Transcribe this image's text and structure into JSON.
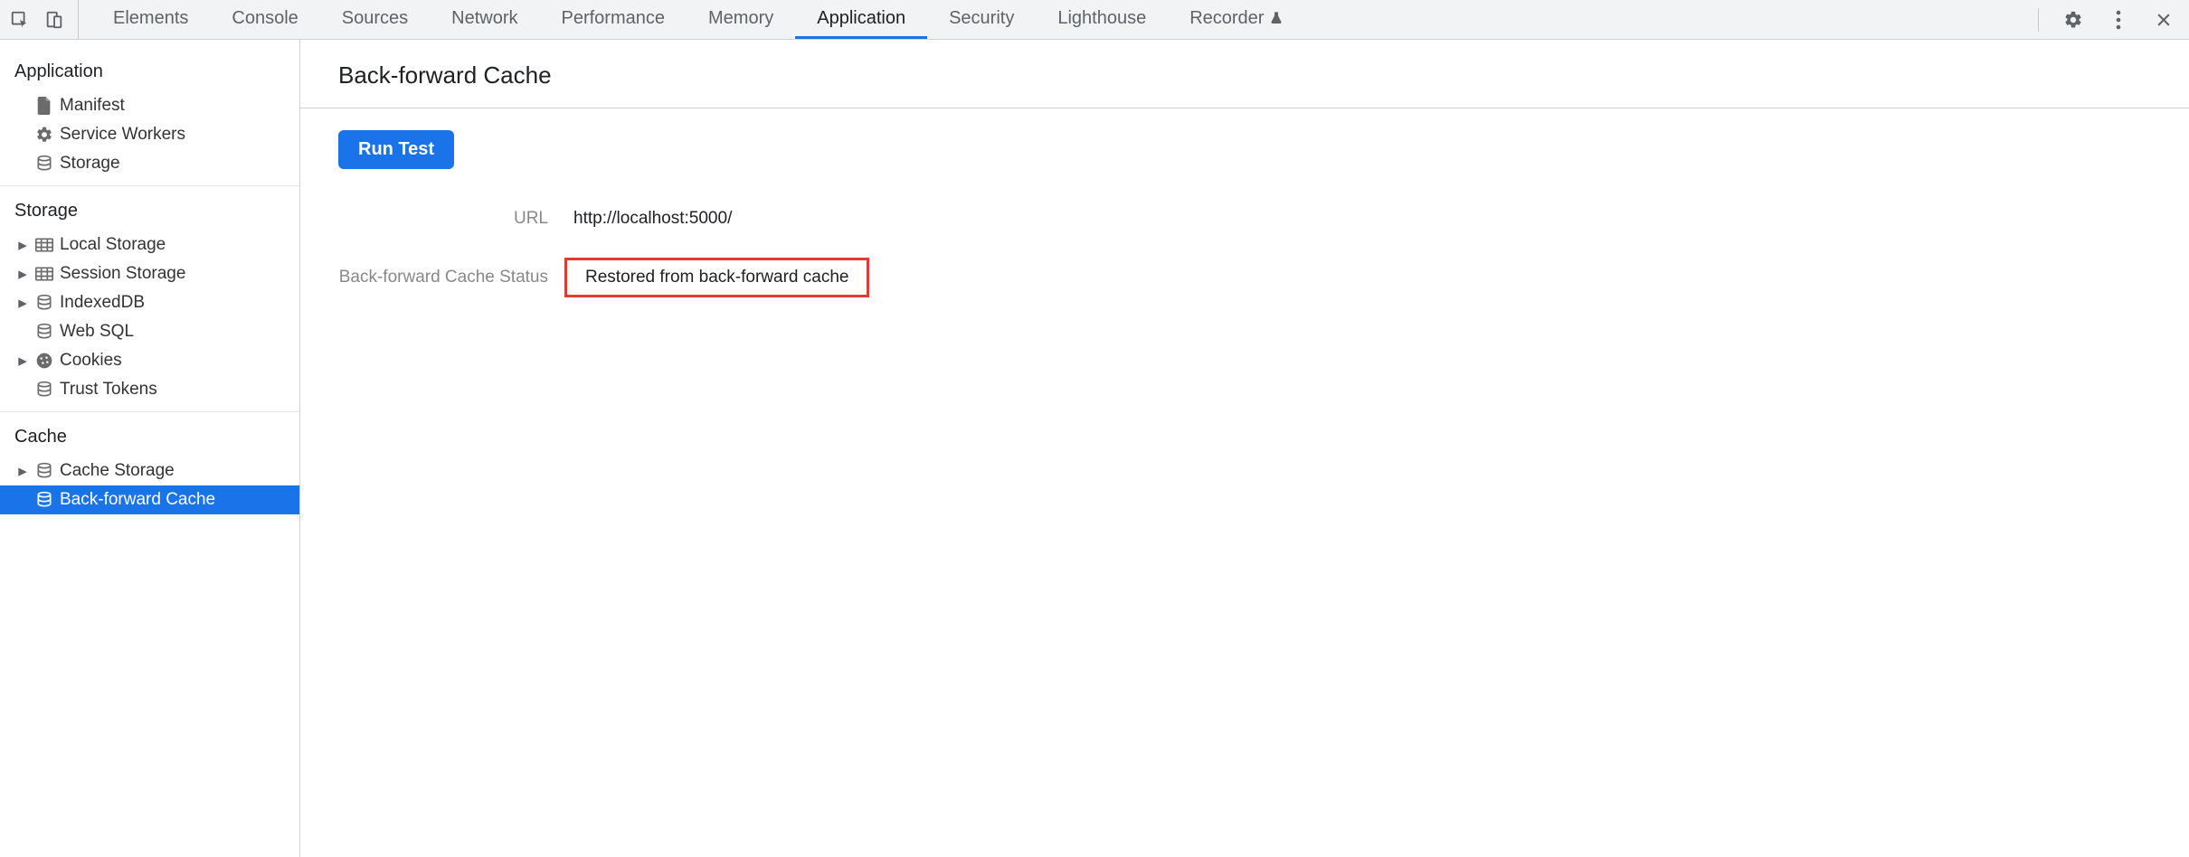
{
  "tabs": {
    "elements": "Elements",
    "console": "Console",
    "sources": "Sources",
    "network": "Network",
    "performance": "Performance",
    "memory": "Memory",
    "application": "Application",
    "security": "Security",
    "lighthouse": "Lighthouse",
    "recorder": "Recorder"
  },
  "sidebar": {
    "application": {
      "title": "Application",
      "manifest": "Manifest",
      "service_workers": "Service Workers",
      "storage": "Storage"
    },
    "storage": {
      "title": "Storage",
      "local_storage": "Local Storage",
      "session_storage": "Session Storage",
      "indexeddb": "IndexedDB",
      "web_sql": "Web SQL",
      "cookies": "Cookies",
      "trust_tokens": "Trust Tokens"
    },
    "cache": {
      "title": "Cache",
      "cache_storage": "Cache Storage",
      "bfcache": "Back-forward Cache"
    }
  },
  "content": {
    "title": "Back-forward Cache",
    "run_test": "Run Test",
    "url_label": "URL",
    "url_value": "http://localhost:5000/",
    "status_label": "Back-forward Cache Status",
    "status_value": "Restored from back-forward cache"
  }
}
